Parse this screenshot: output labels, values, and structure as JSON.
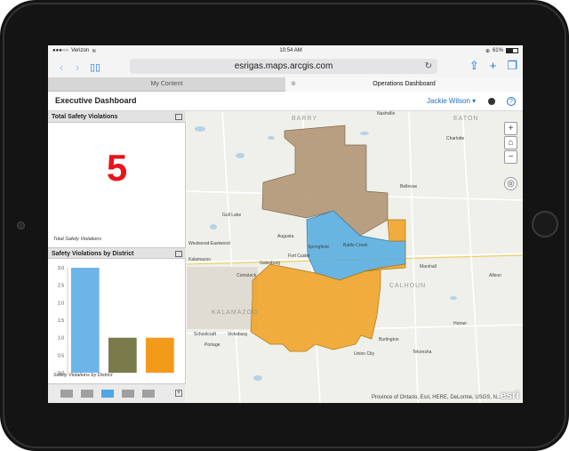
{
  "status": {
    "carrier": "Verizon",
    "time": "10:54 AM",
    "battery": "61%",
    "battery_level": 0.61
  },
  "browser": {
    "url": "esrigas.maps.arcgis.com",
    "tabs": [
      "My Content",
      "Operations Dashboard"
    ],
    "active_tab": 1
  },
  "app": {
    "title": "Executive Dashboard",
    "user": "Jackie Wilson"
  },
  "widgets": {
    "total_safety": {
      "title": "Total Safety Violations",
      "value": "5",
      "caption": "Total Safety Violations"
    },
    "by_district": {
      "title": "Safety Violations by District",
      "caption": "Safety Violations by District"
    }
  },
  "chart_data": {
    "type": "bar",
    "title": "",
    "categories": [
      "",
      "",
      ""
    ],
    "values": [
      3.0,
      1.0,
      1.0
    ],
    "colors": [
      "#6db5e8",
      "#7b7a4b",
      "#f39a1a"
    ],
    "ylim": [
      0,
      3.0
    ],
    "yticks": [
      "0.0",
      "0.5",
      "1.0",
      "1.5",
      "2.0",
      "2.5",
      "3.0"
    ]
  },
  "pager": {
    "count": 5,
    "active_index": 2
  },
  "map": {
    "attribution": "Province of Ontario, Esri, HERE, DeLorme, USGS, N...",
    "logo": "esri",
    "counties": [
      "BARRY",
      "EATON",
      "KALAMAZOO",
      "CALHOUN"
    ],
    "places": [
      {
        "name": "Nashville"
      },
      {
        "name": "Charlotte"
      },
      {
        "name": "Bellevue"
      },
      {
        "name": "Augusta"
      },
      {
        "name": "Springfield"
      },
      {
        "name": "Battle Creek"
      },
      {
        "name": "Galesburg"
      },
      {
        "name": "Marshall"
      },
      {
        "name": "Albion"
      },
      {
        "name": "Comstock"
      },
      {
        "name": "Kalamazoo"
      },
      {
        "name": "Portage"
      },
      {
        "name": "Schoolcraft"
      },
      {
        "name": "Vicksburg"
      },
      {
        "name": "Burlington"
      },
      {
        "name": "Union City"
      },
      {
        "name": "Tekonsha"
      },
      {
        "name": "Homer"
      },
      {
        "name": "Westwood-Eastwood"
      },
      {
        "name": "Fort Custer"
      },
      {
        "name": "Gull Lake"
      }
    ]
  }
}
